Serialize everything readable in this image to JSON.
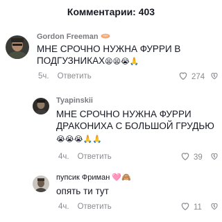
{
  "header": {
    "title": "Комментарии: 403"
  },
  "comments": [
    {
      "username": "Gordon Freeman",
      "text_line1": "МНЕ СРОЧНО НУЖНА ФУРРИ В",
      "text_line2": "ПОДГУЗНИКАХ",
      "emojis": "😫😫😭🙏",
      "time": "5ч.",
      "reply_label": "Ответить",
      "likes": "274"
    },
    {
      "username": "Tyapinskii",
      "text_line1": "МНЕ СРОЧНО НУЖНА ФУРРИ",
      "text_line2": "ДРАКОНИХА С БОЛЬШОЙ ГРУДЬЮ",
      "emojis": "😭😭😭🙏🙏",
      "time": "4ч.",
      "reply_label": "Ответить",
      "likes": "39"
    },
    {
      "username": "пупсик Фриман",
      "username_emojis": "🩷🙈",
      "text_line1": "опять ти тут",
      "time": "4ч.",
      "reply_label": "Ответить",
      "likes": "11"
    }
  ],
  "colors": {
    "text": "#161823",
    "muted": "#8a8b91",
    "username": "#7a7b80",
    "background": "#ffffff"
  },
  "icons": {
    "like": "heart-outline-icon",
    "dislike": "broken-heart-outline-icon"
  }
}
